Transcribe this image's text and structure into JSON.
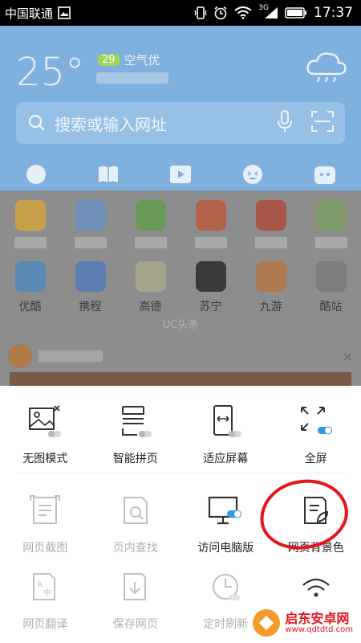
{
  "status_bar": {
    "carrier": "中国联通",
    "time": "17:37",
    "network": "3G",
    "icons": [
      "image-icon",
      "vibrate-icon",
      "alarm-icon",
      "wifi-icon",
      "signal-icon",
      "battery-icon"
    ]
  },
  "weather": {
    "temperature": "25°",
    "aqi_value": "29",
    "aqi_label": "空气优"
  },
  "search": {
    "placeholder": "搜索或输入网址"
  },
  "nav": [
    {
      "label": "网址",
      "icon": "globe-icon"
    },
    {
      "label": "小说",
      "icon": "book-icon"
    },
    {
      "label": "视频",
      "icon": "play-icon"
    },
    {
      "label": "奇趣",
      "icon": "smile-icon"
    },
    {
      "label": "漫画",
      "icon": "comic-icon"
    }
  ],
  "apps_row2": [
    {
      "label": "优酷",
      "color": "#1c8fd6"
    },
    {
      "label": "携程",
      "color": "#2a7fd0"
    },
    {
      "label": "高德",
      "color": "#d9d19a"
    },
    {
      "label": "苏宁",
      "color": "#3a3a3a"
    },
    {
      "label": "九游",
      "color": "#f08a3a"
    },
    {
      "label": "酷站",
      "color": "#7d7d7d"
    }
  ],
  "apps_row1_colors": [
    "#f0b52a",
    "#2a73c8",
    "#3aa64a",
    "#e85b2a",
    "#d8452a",
    "#6aa54a"
  ],
  "feed": {
    "title": "UC头条",
    "close": "×"
  },
  "tools_row1": [
    {
      "label": "无图模式",
      "icon": "no-image-icon",
      "toggle": "off"
    },
    {
      "label": "智能拼页",
      "icon": "page-join-icon",
      "toggle": "off"
    },
    {
      "label": "适应屏幕",
      "icon": "fit-screen-icon",
      "toggle": "off"
    },
    {
      "label": "全屏",
      "icon": "fullscreen-icon",
      "toggle": "on"
    }
  ],
  "tools_row2": [
    {
      "label": "网页截图",
      "icon": "screenshot-icon",
      "enabled": false
    },
    {
      "label": "页内查找",
      "icon": "find-in-page-icon",
      "enabled": false
    },
    {
      "label": "访问电脑版",
      "icon": "desktop-icon",
      "enabled": true,
      "toggle": "on"
    },
    {
      "label": "网页背景色",
      "icon": "page-color-icon",
      "enabled": true
    }
  ],
  "tools_row3": [
    {
      "label": "网页翻译",
      "icon": "translate-icon",
      "enabled": false
    },
    {
      "label": "保存网页",
      "icon": "save-page-icon",
      "enabled": false
    },
    {
      "label": "定时刷新",
      "icon": "timer-refresh-icon",
      "enabled": false
    },
    {
      "label": "",
      "icon": "wifi-share-icon",
      "enabled": true
    }
  ],
  "colors": {
    "accent": "#2d9ae8",
    "highlight_circle": "#e8141b"
  },
  "watermark": {
    "name": "启东安卓网",
    "url": "www.qdtdtd.com"
  }
}
